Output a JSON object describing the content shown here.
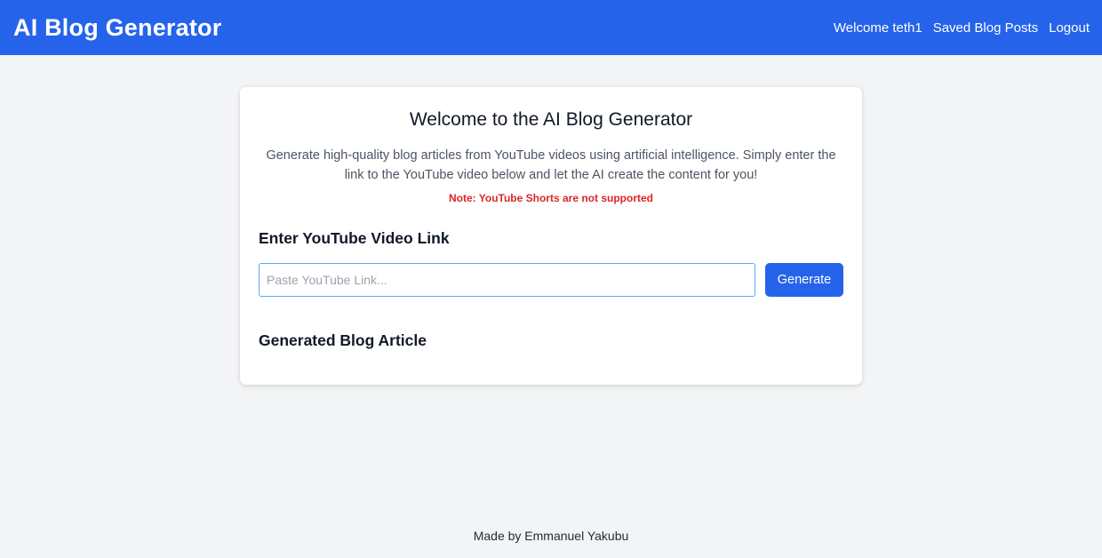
{
  "navbar": {
    "brand": "AI Blog Generator",
    "welcome": "Welcome teth1",
    "saved_posts": "Saved Blog Posts",
    "logout": "Logout"
  },
  "main": {
    "title": "Welcome to the AI Blog Generator",
    "description": "Generate high-quality blog articles from YouTube videos using artificial intelligence. Simply enter the link to the YouTube video below and let the AI create the content for you!",
    "note": "Note: YouTube Shorts are not supported",
    "link_heading": "Enter YouTube Video Link",
    "link_input": {
      "value": "",
      "placeholder": "Paste YouTube Link..."
    },
    "generate_label": "Generate",
    "article_heading": "Generated Blog Article"
  },
  "footer": {
    "text": "Made by Emmanuel Yakubu"
  },
  "colors": {
    "primary": "#2563eb",
    "background": "#f3f4f6",
    "note": "#dc2626"
  }
}
